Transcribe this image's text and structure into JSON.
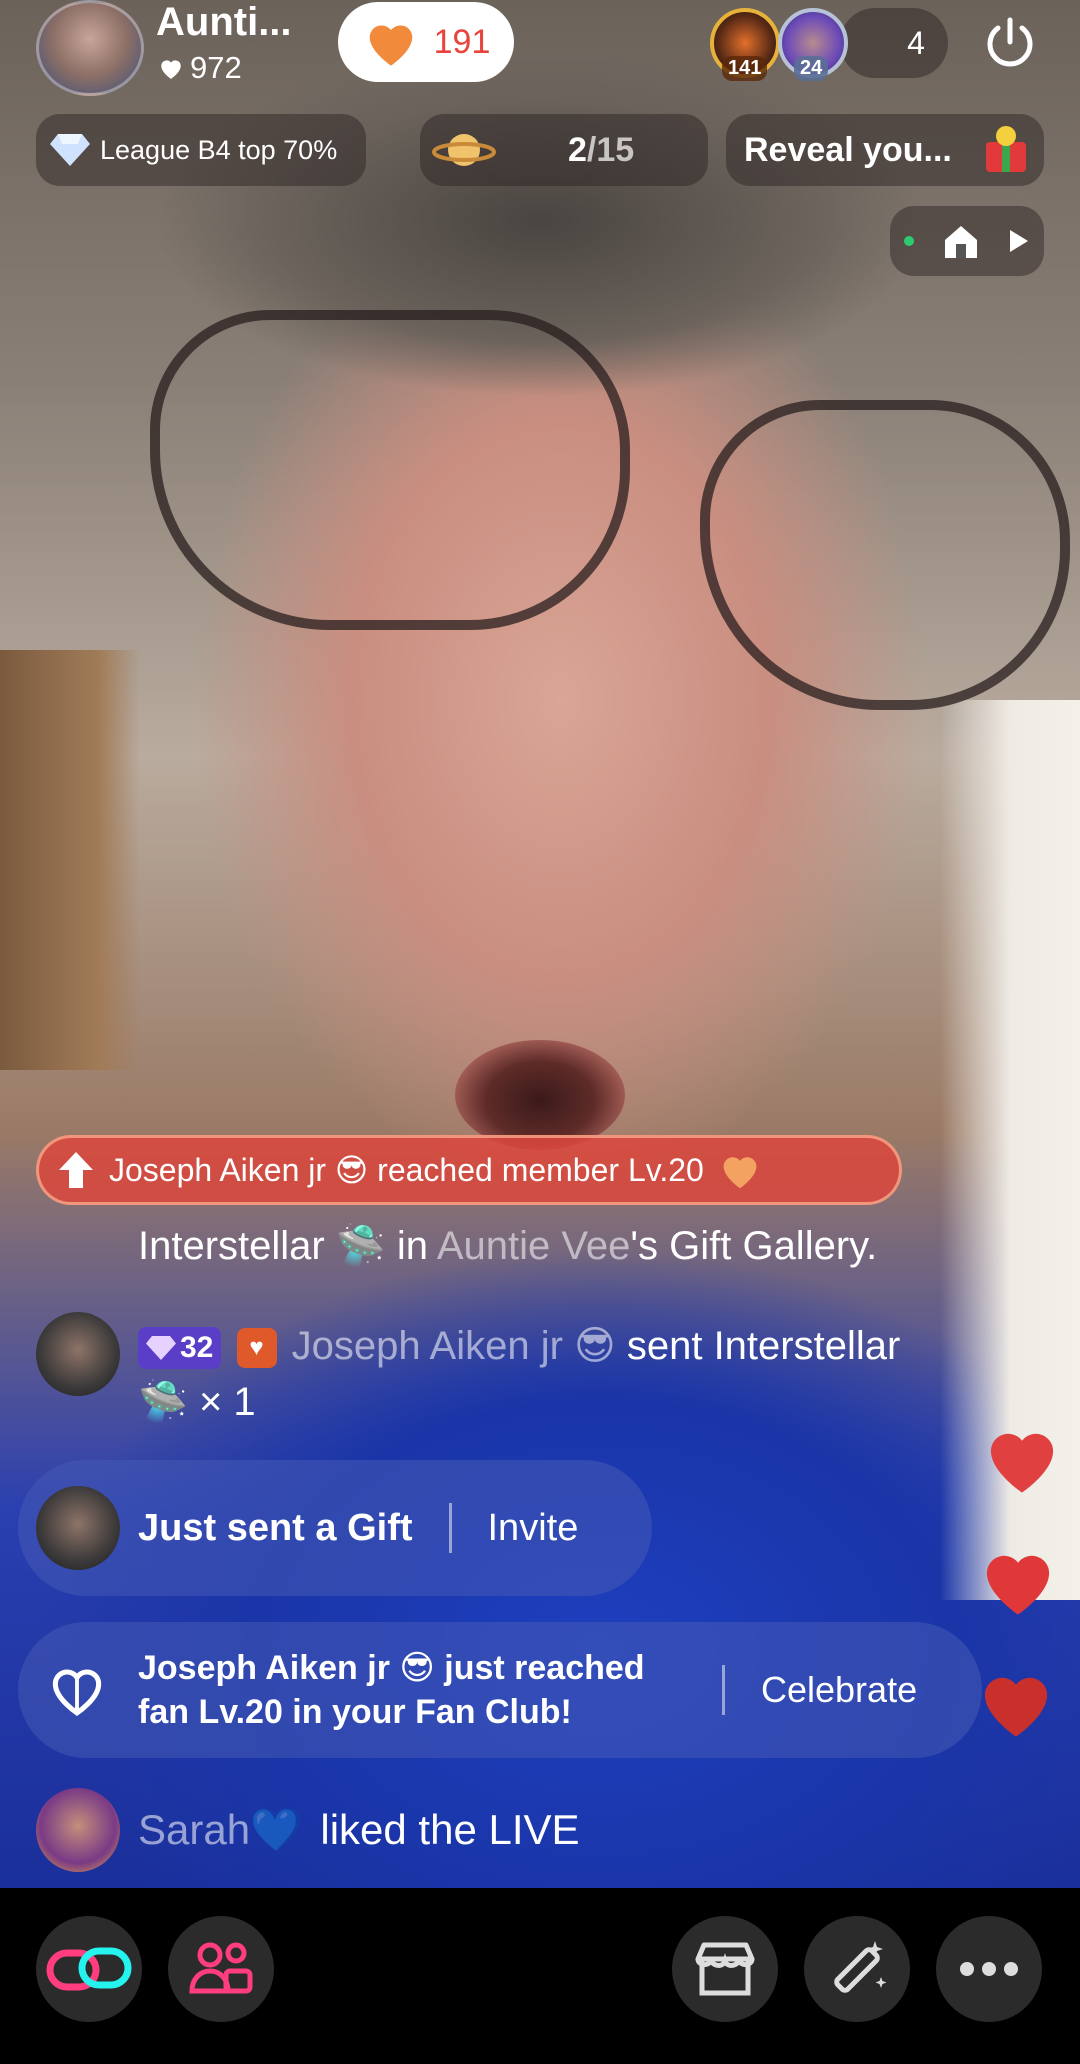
{
  "host": {
    "name": "Aunti...",
    "likes": "972"
  },
  "like_counter": "191",
  "viewers": {
    "badge1": "141",
    "badge2": "24",
    "count": "4"
  },
  "league": {
    "label": "League B4 top 70%"
  },
  "goal": {
    "current": "2",
    "total": "/15"
  },
  "reveal": {
    "label": "Reveal you..."
  },
  "chat": {
    "member_banner": "Joseph Aiken jr 😎 reached member Lv.20",
    "gallery_line": {
      "gift": "Interstellar",
      "in": "in",
      "owner": "Auntie  Vee",
      "rest": "'s Gift Gallery."
    },
    "gift_message": {
      "level": "32",
      "user": "Joseph Aiken jr 😎",
      "action": "sent Interstellar",
      "count": "× 1"
    },
    "sent_card": {
      "text": "Just sent a Gift",
      "button": "Invite"
    },
    "fan_card": {
      "text": "Joseph Aiken jr 😎 just reached fan Lv.20 in your Fan Club!",
      "button": "Celebrate"
    },
    "liked": {
      "user": "Sarah💙",
      "action": "liked the LIVE"
    }
  },
  "colors": {
    "accent_red": "#e8433c",
    "banner_red": "#dc463c",
    "card_blue": "#465ab4",
    "bar_dark": "#2b2b2b"
  }
}
